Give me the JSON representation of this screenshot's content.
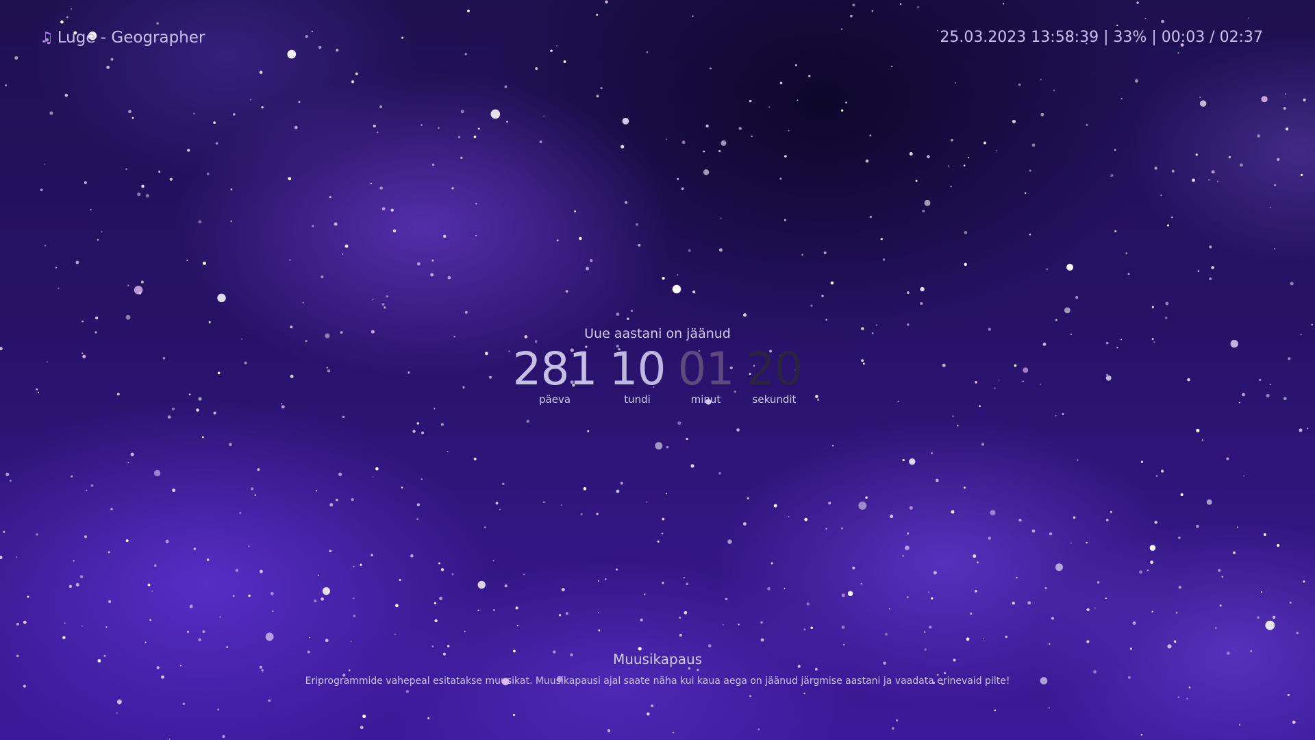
{
  "now_playing": {
    "icon": "music-note-icon",
    "track": "Luge - Geographer"
  },
  "status": {
    "text": "25.03.2023 13:58:39 | 33% | 00:03 / 02:37"
  },
  "countdown": {
    "title": "Uue aastani on jäänud",
    "units": [
      {
        "value": "281",
        "label": "päeva"
      },
      {
        "value": "10",
        "label": "tundi"
      },
      {
        "value": "01",
        "label": "minut"
      },
      {
        "value": "20",
        "label": "sekundit"
      }
    ]
  },
  "footer": {
    "title": "Muusikapaus",
    "text": "Eriprogrammide vahepeal esitatakse muusikat. Muusikapausi ajal saate näha kui kaua aega on jäänud järgmise aastani ja vaadata erinevaid pilte!"
  },
  "colors": {
    "accent": "#b07be8",
    "text": "#c9c0ef",
    "background_deep": "#1f1050",
    "nebula": "#6e3ce6"
  }
}
